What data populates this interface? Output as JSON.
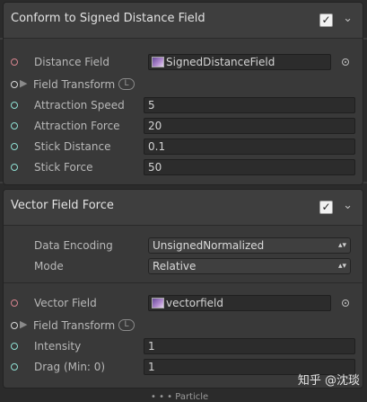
{
  "block1": {
    "title": "Conform to Signed Distance Field",
    "rows": [
      {
        "label": "Distance Field",
        "value": "SignedDistanceField"
      },
      {
        "label": "Field Transform",
        "badge": "L"
      },
      {
        "label": "Attraction Speed",
        "value": "5"
      },
      {
        "label": "Attraction Force",
        "value": "20"
      },
      {
        "label": "Stick Distance",
        "value": "0.1"
      },
      {
        "label": "Stick Force",
        "value": "50"
      }
    ]
  },
  "block2": {
    "title": "Vector Field Force",
    "settings": [
      {
        "label": "Data Encoding",
        "value": "UnsignedNormalized"
      },
      {
        "label": "Mode",
        "value": "Relative"
      }
    ],
    "rows": [
      {
        "label": "Vector Field",
        "value": "vectorfield"
      },
      {
        "label": "Field Transform",
        "badge": "L"
      },
      {
        "label": "Intensity",
        "value": "1"
      },
      {
        "label": "Drag (Min: 0)",
        "value": "1"
      }
    ]
  },
  "icons": {
    "check": "✓",
    "chevron": "⌄",
    "expand": "▶",
    "dropdown": "▴▾"
  },
  "watermark": "知乎 @沈琰",
  "footer": "• • •  Particle",
  "colors": {
    "port_red": "#d6848e",
    "port_white": "#d8d8d8",
    "port_cyan": "#8fe0d3"
  }
}
